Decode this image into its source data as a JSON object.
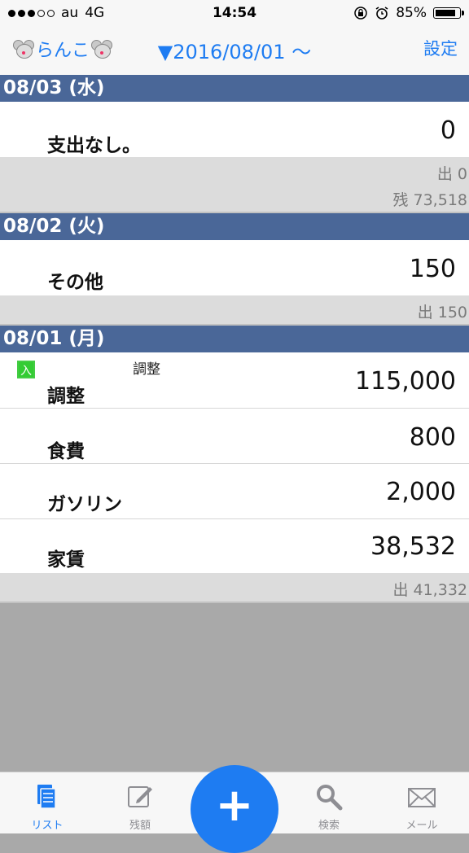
{
  "status_bar": {
    "carrier": "au",
    "network": "4G",
    "time": "14:54",
    "battery": "85%"
  },
  "nav": {
    "title": "らんこ",
    "period": "▼2016/08/01 〜",
    "settings": "設定"
  },
  "days": [
    {
      "header": "08/03 (水)",
      "entries": [
        {
          "category": "支出なし。",
          "amount": "0"
        }
      ],
      "expense": "出 0",
      "balance": "残 73,518"
    },
    {
      "header": "08/02 (火)",
      "entries": [
        {
          "category": "その他",
          "amount": "150"
        }
      ],
      "expense": "出 150"
    },
    {
      "header": "08/01 (月)",
      "entries": [
        {
          "category": "調整",
          "amount": "115,000",
          "memo": "調整",
          "badge": "入"
        },
        {
          "category": "食費",
          "amount": "800"
        },
        {
          "category": "ガソリン",
          "amount": "2,000"
        },
        {
          "category": "家賃",
          "amount": "38,532"
        }
      ],
      "expense": "出 41,332"
    }
  ],
  "tabbar": {
    "items": [
      {
        "label": "リスト",
        "icon": "list-icon"
      },
      {
        "label": "残額",
        "icon": "edit-icon"
      },
      {
        "label": "検索",
        "icon": "search-icon"
      },
      {
        "label": "メール",
        "icon": "mail-icon"
      }
    ],
    "add_label": "+"
  },
  "colors": {
    "accent": "#1e7cf2",
    "date_header": "#4a6798",
    "summary_bg": "#dcdcdc",
    "income_badge": "#33cc33"
  }
}
